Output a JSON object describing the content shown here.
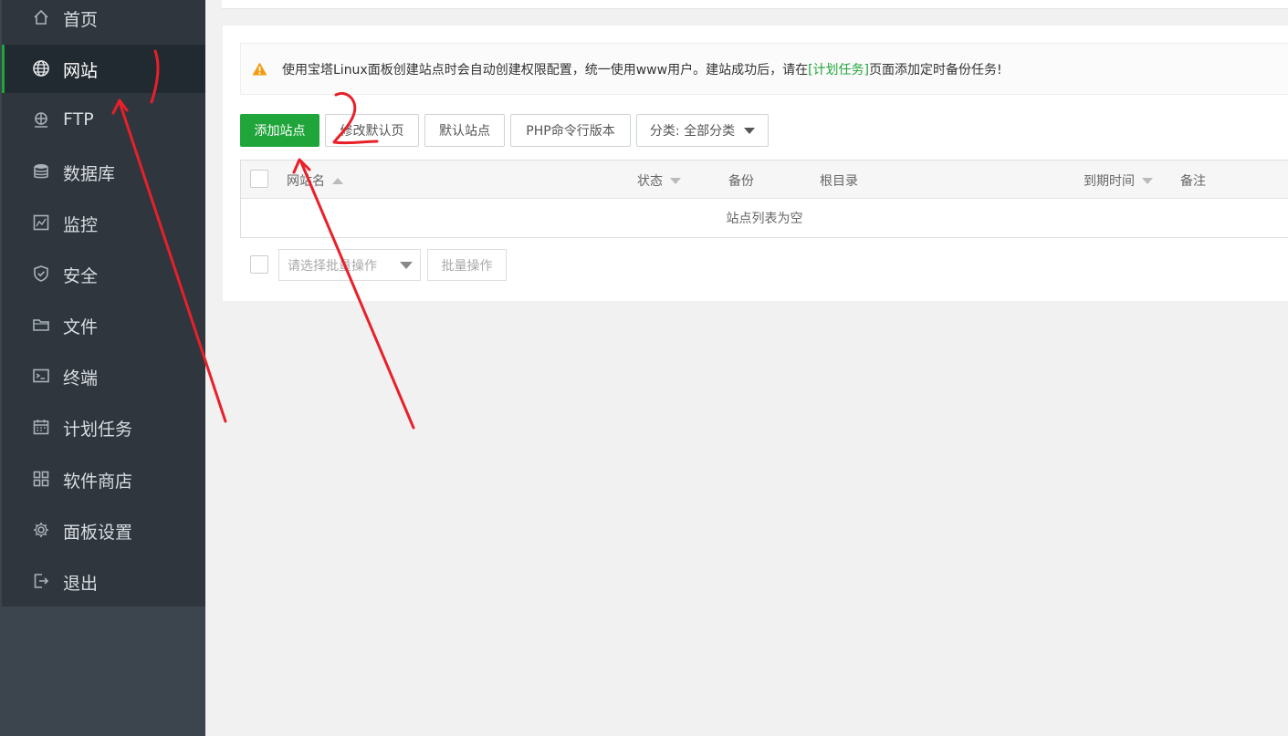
{
  "sidebar": {
    "items": [
      {
        "label": "首页",
        "icon": "home-icon"
      },
      {
        "label": "网站",
        "icon": "globe-icon",
        "active": true
      },
      {
        "label": "FTP",
        "icon": "ftp-icon"
      },
      {
        "label": "数据库",
        "icon": "database-icon"
      },
      {
        "label": "监控",
        "icon": "monitor-icon"
      },
      {
        "label": "安全",
        "icon": "shield-icon"
      },
      {
        "label": "文件",
        "icon": "folder-icon"
      },
      {
        "label": "终端",
        "icon": "terminal-icon"
      },
      {
        "label": "计划任务",
        "icon": "calendar-icon"
      },
      {
        "label": "软件商店",
        "icon": "grid-icon"
      },
      {
        "label": "面板设置",
        "icon": "gear-icon"
      },
      {
        "label": "退出",
        "icon": "logout-icon"
      }
    ]
  },
  "notice": {
    "text_before": "使用宝塔Linux面板创建站点时会自动创建权限配置，统一使用www用户。建站成功后，请在",
    "link": "[计划任务]",
    "text_after": "页面添加定时备份任务!"
  },
  "toolbar": {
    "add_site": "添加站点",
    "modify_default": "修改默认页",
    "default_site": "默认站点",
    "php_cli": "PHP命令行版本",
    "category": "分类: 全部分类"
  },
  "table": {
    "headers": {
      "site_name": "网站名",
      "status": "状态",
      "backup": "备份",
      "root_dir": "根目录",
      "expire": "到期时间",
      "note": "备注"
    },
    "empty_text": "站点列表为空"
  },
  "batch": {
    "placeholder": "请选择批量操作",
    "button": "批量操作"
  },
  "colors": {
    "accent": "#20a53a",
    "sidebar_bg": "#2f363d",
    "annotation": "#e8202a"
  }
}
